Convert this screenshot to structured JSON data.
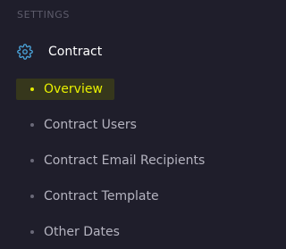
{
  "sidebar": {
    "section_title": "SETTINGS",
    "group": {
      "label": "Contract",
      "icon": "gear-icon"
    },
    "items": [
      {
        "label": "Overview",
        "active": true
      },
      {
        "label": "Contract Users",
        "active": false
      },
      {
        "label": "Contract Email Recipients",
        "active": false
      },
      {
        "label": "Contract Template",
        "active": false
      },
      {
        "label": "Other Dates",
        "active": false
      }
    ]
  },
  "colors": {
    "background": "#1f1e2b",
    "accent": "#e9f100",
    "icon": "#4aa3d9",
    "text": "#b5b4c0",
    "section_title": "#5d5c6b"
  }
}
